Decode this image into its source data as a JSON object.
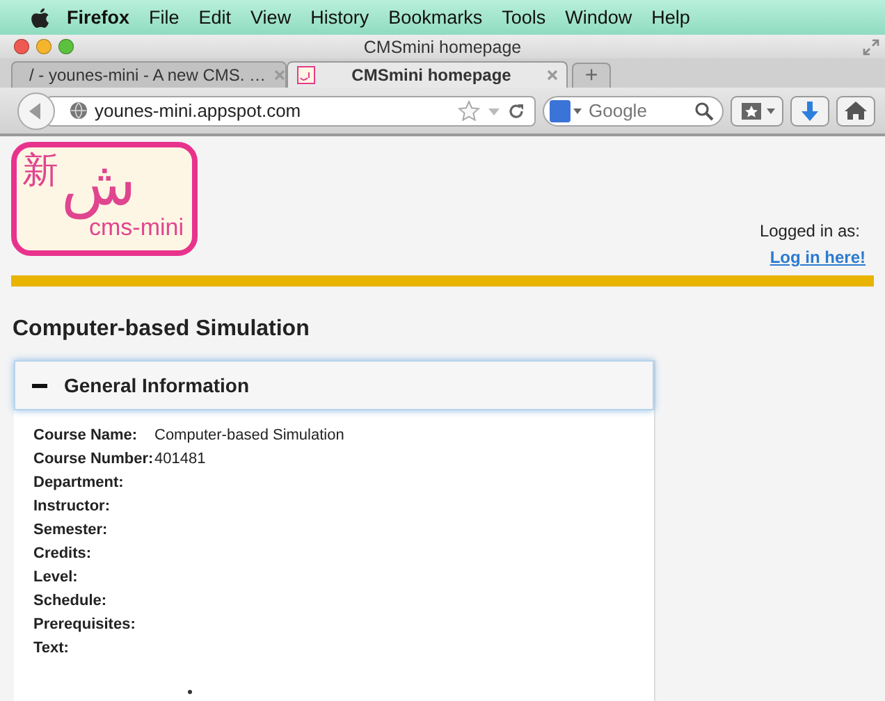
{
  "menu_bar": {
    "app": "Firefox",
    "items": [
      "File",
      "Edit",
      "View",
      "History",
      "Bookmarks",
      "Tools",
      "Window",
      "Help"
    ]
  },
  "window": {
    "title": "CMSmini homepage"
  },
  "tabs": [
    {
      "label": "/ - younes-mini - A new CMS. …",
      "selected": false
    },
    {
      "label": "CMSmini homepage",
      "selected": true
    }
  ],
  "new_tab": "+",
  "toolbar": {
    "url": "younes-mini.appspot.com",
    "search_placeholder": "Google"
  },
  "logo": {
    "glyph": "新",
    "arabic": "ش",
    "text": "cms-mini"
  },
  "login": {
    "status": "Logged in as:",
    "link": "Log in here!"
  },
  "page_title": "Computer-based Simulation",
  "panel": {
    "title": "General Information",
    "expanded": true,
    "fields": [
      {
        "label": "Course Name:",
        "value": "Computer-based Simulation"
      },
      {
        "label": "Course Number:",
        "value": "401481"
      },
      {
        "label": "Department:"
      },
      {
        "label": "Instructor:"
      },
      {
        "label": "Semester:"
      },
      {
        "label": "Credits:"
      },
      {
        "label": "Level:"
      },
      {
        "label": "Schedule:"
      },
      {
        "label": "Prerequisites:"
      },
      {
        "label": "Text:"
      }
    ]
  }
}
